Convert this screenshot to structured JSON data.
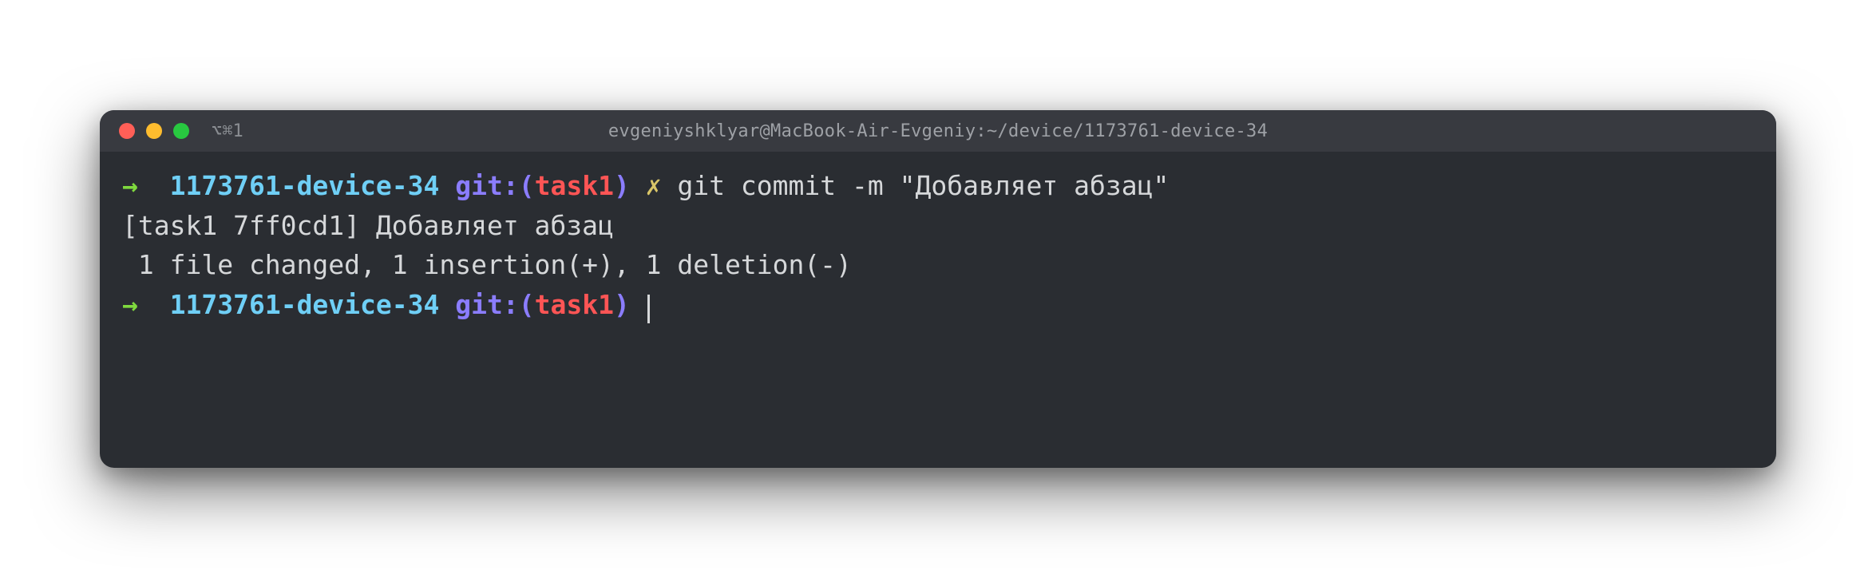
{
  "window": {
    "tab_label": "⌥⌘1",
    "title": "evgeniyshklyar@MacBook-Air-Evgeniy:~/device/1173761-device-34"
  },
  "prompt1": {
    "arrow": "→",
    "cwd": "1173761-device-34",
    "git_label": "git:(",
    "branch": "task1",
    "git_close": ")",
    "dirty": "✗",
    "command": "git commit -m \"Добавляет абзац\""
  },
  "output": {
    "line1": "[task1 7ff0cd1] Добавляет абзац",
    "line2": " 1 file changed, 1 insertion(+), 1 deletion(-)"
  },
  "prompt2": {
    "arrow": "→",
    "cwd": "1173761-device-34",
    "git_label": "git:(",
    "branch": "task1",
    "git_close": ")"
  }
}
